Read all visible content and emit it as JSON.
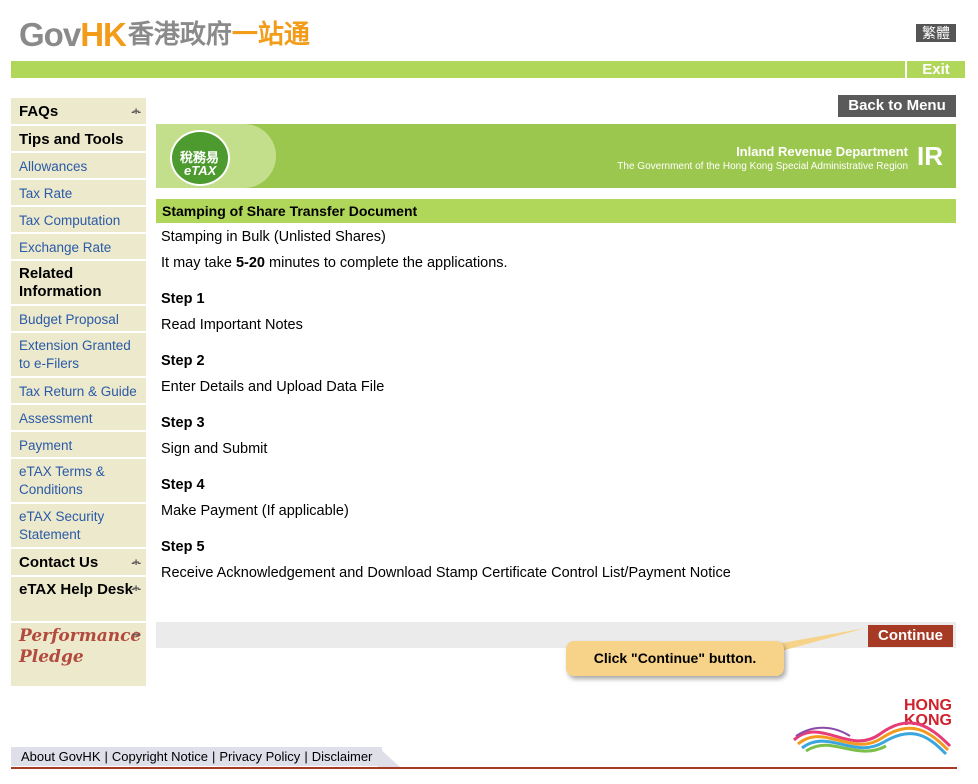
{
  "header": {
    "logo_gov": "Gov",
    "logo_hk": "HK",
    "logo_cn_grey": "香港政府",
    "logo_cn_orange": "一站通",
    "lang_label": "繁體",
    "exit_label": "Exit"
  },
  "sidebar": {
    "faqs": "FAQs",
    "tips_tools": "Tips and Tools",
    "tips_items": [
      "Allowances",
      "Tax Rate",
      "Tax Computation",
      "Exchange Rate"
    ],
    "related_info": "Related Information",
    "related_items": [
      "Budget Proposal",
      "Extension Granted to e-Filers",
      "Tax Return & Guide",
      "Assessment",
      "Payment",
      "eTAX Terms & Conditions",
      "eTAX Security Statement"
    ],
    "contact_us": "Contact Us",
    "help_desk": "eTAX Help Desk",
    "performance_1": "Performance",
    "performance_2": "Pledge"
  },
  "toolbar": {
    "back_label": "Back to Menu"
  },
  "banner": {
    "etax_cn": "稅務易",
    "etax_en": "eTAX",
    "department": "Inland Revenue Department",
    "government": "The Government of the Hong Kong Special Administrative Region",
    "ird_logo": "IR"
  },
  "main": {
    "section_title": "Stamping of Share Transfer Document",
    "subtitle": "Stamping in Bulk (Unlisted Shares)",
    "time_prefix": "It may take ",
    "time_value": "5-20",
    "time_suffix": " minutes to complete the applications.",
    "steps": [
      {
        "title": "Step 1",
        "text": "Read Important Notes"
      },
      {
        "title": "Step 2",
        "text": "Enter Details and Upload Data File"
      },
      {
        "title": "Step 3",
        "text": "Sign and Submit"
      },
      {
        "title": "Step 4",
        "text": "Make Payment (If applicable)"
      },
      {
        "title": "Step 5",
        "text": "Receive Acknowledgement and Download Stamp Certificate Control List/Payment Notice"
      }
    ],
    "continue_label": "Continue",
    "tooltip": "Click \"Continue\" button."
  },
  "footer": {
    "links": [
      "About GovHK",
      "Copyright Notice",
      "Privacy Policy",
      "Disclaimer"
    ],
    "brand_1": "HONG",
    "brand_2": "KONG"
  },
  "colors": {
    "green": "#b1d75a",
    "sidebar_bg": "#ece9cc",
    "link": "#2a5aa8",
    "continue": "#a63a25",
    "tooltip": "#f7d38a"
  }
}
